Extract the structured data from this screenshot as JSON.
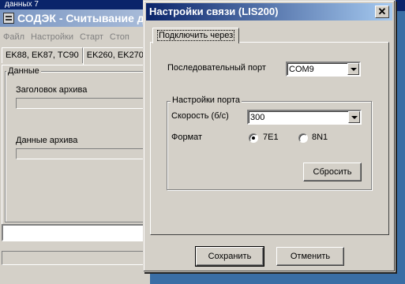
{
  "background_window": {
    "top_strip_text": "данных 7",
    "title": "СОДЭК - Считывание да",
    "menu": [
      "Файл",
      "Настройки",
      "Старт",
      "Стоп"
    ],
    "tabs": [
      "EK88, EK87, TC90",
      "EK260, EK270,"
    ],
    "group_label": "Данные",
    "archive_header_label": "Заголовок архива",
    "archive_data_label": "Данные архива"
  },
  "dialog": {
    "title": "Настройки связи (LIS200)",
    "close_glyph": "✕",
    "tab_label": "Подключить через",
    "serial_port_label": "Последовательный порт",
    "serial_port_value": "COM9",
    "port_settings_label": "Настройки порта",
    "speed_label": "Скорость (б/с)",
    "speed_value": "300",
    "format_label": "Формат",
    "format_options": [
      "7E1",
      "8N1"
    ],
    "format_selected": "7E1",
    "reset_button": "Сбросить",
    "save_button": "Сохранить",
    "cancel_button": "Отменить"
  }
}
